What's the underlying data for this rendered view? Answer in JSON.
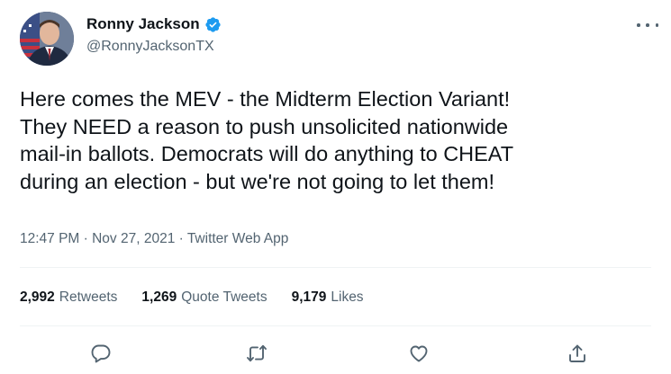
{
  "user": {
    "display_name": "Ronny Jackson",
    "handle": "@RonnyJacksonTX",
    "verified": true
  },
  "tweet": {
    "text": "Here comes the MEV - the Midterm Election Variant!\nThey NEED a reason to push unsolicited nationwide\nmail-in ballots. Democrats will do anything to CHEAT\nduring an election - but we're not going to let them!",
    "timestamp": "12:47 PM · Nov 27, 2021 · Twitter Web App"
  },
  "stats": [
    {
      "count": "2,992",
      "label": "Retweets"
    },
    {
      "count": "1,269",
      "label": "Quote Tweets"
    },
    {
      "count": "9,179",
      "label": "Likes"
    }
  ],
  "icons": {
    "verified": "verified-badge-icon",
    "more": "more-options-icon",
    "reply": "reply-icon",
    "retweet": "retweet-icon",
    "like": "like-icon",
    "share": "share-icon"
  },
  "colors": {
    "text": "#0f1419",
    "secondary": "#536471",
    "verified": "#1d9bf0",
    "divider": "#eff3f4"
  }
}
